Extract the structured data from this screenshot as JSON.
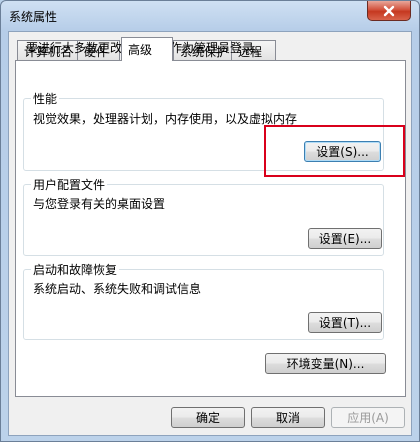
{
  "window": {
    "title": "系统属性"
  },
  "tabs": [
    {
      "label": "计算机名"
    },
    {
      "label": "硬件"
    },
    {
      "label": "高级"
    },
    {
      "label": "系统保护"
    },
    {
      "label": "远程"
    }
  ],
  "notice": "要进行大多数更改，您必须作为管理员登录。",
  "performance": {
    "title": "性能",
    "desc": "视觉效果，处理器计划，内存使用，以及虚拟内存",
    "button": "设置(S)..."
  },
  "user_profiles": {
    "title": "用户配置文件",
    "desc": "与您登录有关的桌面设置",
    "button": "设置(E)..."
  },
  "startup": {
    "title": "启动和故障恢复",
    "desc": "系统启动、系统失败和调试信息",
    "button": "设置(T)..."
  },
  "env_button": "环境变量(N)...",
  "dialog": {
    "ok": "确定",
    "cancel": "取消",
    "apply": "应用(A)"
  },
  "colors": {
    "highlight": "#d9001b",
    "close_button": "#c53820"
  }
}
